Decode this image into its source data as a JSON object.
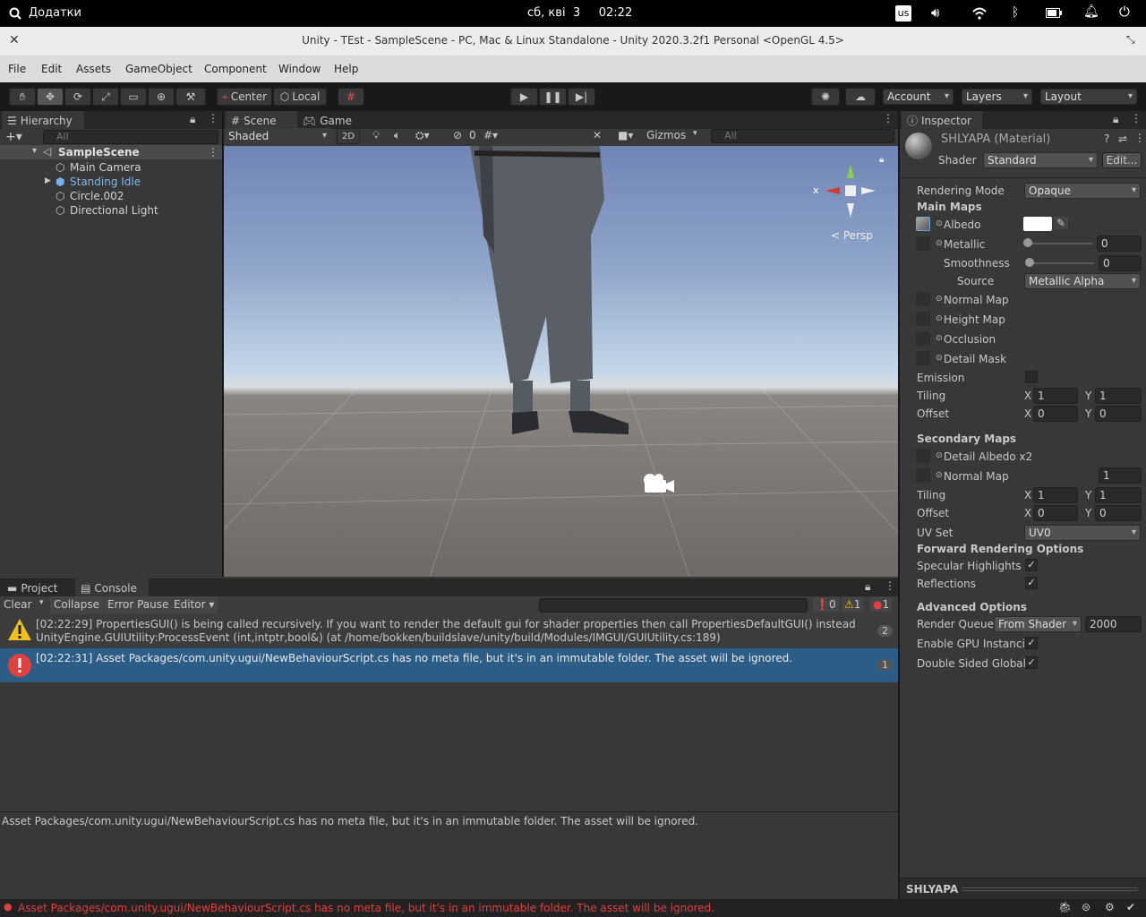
{
  "os_bar": {
    "apps_label": "Додатки",
    "datetime": "сб, кві  3     02:22",
    "keyboard_layout": "us"
  },
  "window": {
    "title": "Unity - TEst - SampleScene - PC, Mac & Linux Standalone - Unity 2020.3.2f1 Personal <OpenGL 4.5>"
  },
  "menu": [
    "File",
    "Edit",
    "Assets",
    "GameObject",
    "Component",
    "Window",
    "Help"
  ],
  "toolbar": {
    "pivot": "Center",
    "space": "Local",
    "account": "Account",
    "layers": "Layers",
    "layout": "Layout"
  },
  "hierarchy": {
    "tab": "Hierarchy",
    "search_placeholder": "All",
    "scene": "SampleScene",
    "items": [
      {
        "label": "Main Camera"
      },
      {
        "label": "Standing Idle"
      },
      {
        "label": "Circle.002"
      },
      {
        "label": "Directional Light"
      }
    ]
  },
  "scene": {
    "tab_scene": "Scene",
    "tab_game": "Game",
    "shading": "Shaded",
    "mode_2d": "2D",
    "hidden_count": "0",
    "gizmos": "Gizmos",
    "search_placeholder": "All",
    "persp": "Persp",
    "axis_x": "x"
  },
  "console": {
    "tab_project": "Project",
    "tab_console": "Console",
    "clear": "Clear",
    "collapse": "Collapse",
    "error_pause": "Error Pause",
    "editor": "Editor",
    "count_info": "0",
    "count_warn": "1",
    "count_error": "1",
    "entries": [
      {
        "line1": "[02:22:29] PropertiesGUI() is being called recursively. If you want to render the default gui for shader properties then call PropertiesDefaultGUI() instead",
        "line2": "UnityEngine.GUIUtility:ProcessEvent (int,intptr,bool&) (at /home/bokken/buildslave/unity/build/Modules/IMGUI/GUIUtility.cs:189)",
        "count": "2"
      },
      {
        "line1": "[02:22:31] Asset Packages/com.unity.ugui/NewBehaviourScript.cs has no meta file, but it's in an immutable folder. The asset will be ignored.",
        "count": "1"
      }
    ],
    "detail": "Asset Packages/com.unity.ugui/NewBehaviourScript.cs has no meta file, but it's in an immutable folder. The asset will be ignored."
  },
  "status_bar": {
    "message": "Asset Packages/com.unity.ugui/NewBehaviourScript.cs has no meta file, but it's in an immutable folder. The asset will be ignored."
  },
  "inspector": {
    "tab": "Inspector",
    "material_name": "SHLYAPA (Material)",
    "shader_label": "Shader",
    "shader": "Standard",
    "edit": "Edit...",
    "rendering_mode_label": "Rendering Mode",
    "rendering_mode": "Opaque",
    "main_maps": "Main Maps",
    "albedo": "Albedo",
    "metallic": "Metallic",
    "metallic_value": "0",
    "smoothness": "Smoothness",
    "smoothness_value": "0",
    "source": "Source",
    "source_value": "Metallic Alpha",
    "normal_map": "Normal Map",
    "height_map": "Height Map",
    "occlusion": "Occlusion",
    "detail_mask": "Detail Mask",
    "emission": "Emission",
    "tiling": "Tiling",
    "offset": "Offset",
    "x": "X",
    "y": "Y",
    "tiling_x": "1",
    "tiling_y": "1",
    "offset_x": "0",
    "offset_y": "0",
    "secondary_maps": "Secondary Maps",
    "detail_albedo": "Detail Albedo x2",
    "normal_map2": "Normal Map",
    "normal_map2_value": "1",
    "tiling2_x": "1",
    "tiling2_y": "1",
    "offset2_x": "0",
    "offset2_y": "0",
    "uv_set": "UV Set",
    "uv_value": "UV0",
    "forward": "Forward Rendering Options",
    "specular": "Specular Highlights",
    "reflections": "Reflections",
    "advanced": "Advanced Options",
    "render_queue": "Render Queue",
    "render_queue_mode": "From Shader",
    "render_queue_value": "2000",
    "gpu_instancing": "Enable GPU Instancir",
    "double_sided": "Double Sided Global I",
    "preview_title": "SHLYAPA"
  }
}
